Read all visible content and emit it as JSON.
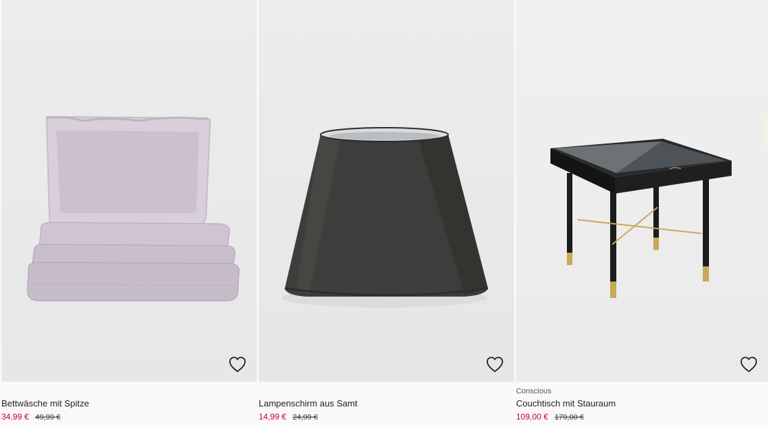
{
  "products": [
    {
      "tag": "",
      "title": "Bettwäsche mit Spitze",
      "price": "34,99 €",
      "old_price": "49,99 €",
      "image_alt": "Bettwäsche lila mit Spitzenrand"
    },
    {
      "tag": "",
      "title": "Lampenschirm aus Samt",
      "price": "14,99 €",
      "old_price": "24,99 €",
      "image_alt": "Lampenschirm aus dunkelgrauem Samt"
    },
    {
      "tag": "Conscious",
      "title": "Couchtisch mit Stauraum",
      "price": "109,00 €",
      "old_price": "179,00 €",
      "image_alt": "Schwarzer Couchtisch mit Glasplatte"
    }
  ],
  "icons": {
    "favorite": "heart-outline-icon"
  },
  "colors": {
    "sale_price": "#c4012d",
    "page_background": "#faf9f8"
  }
}
